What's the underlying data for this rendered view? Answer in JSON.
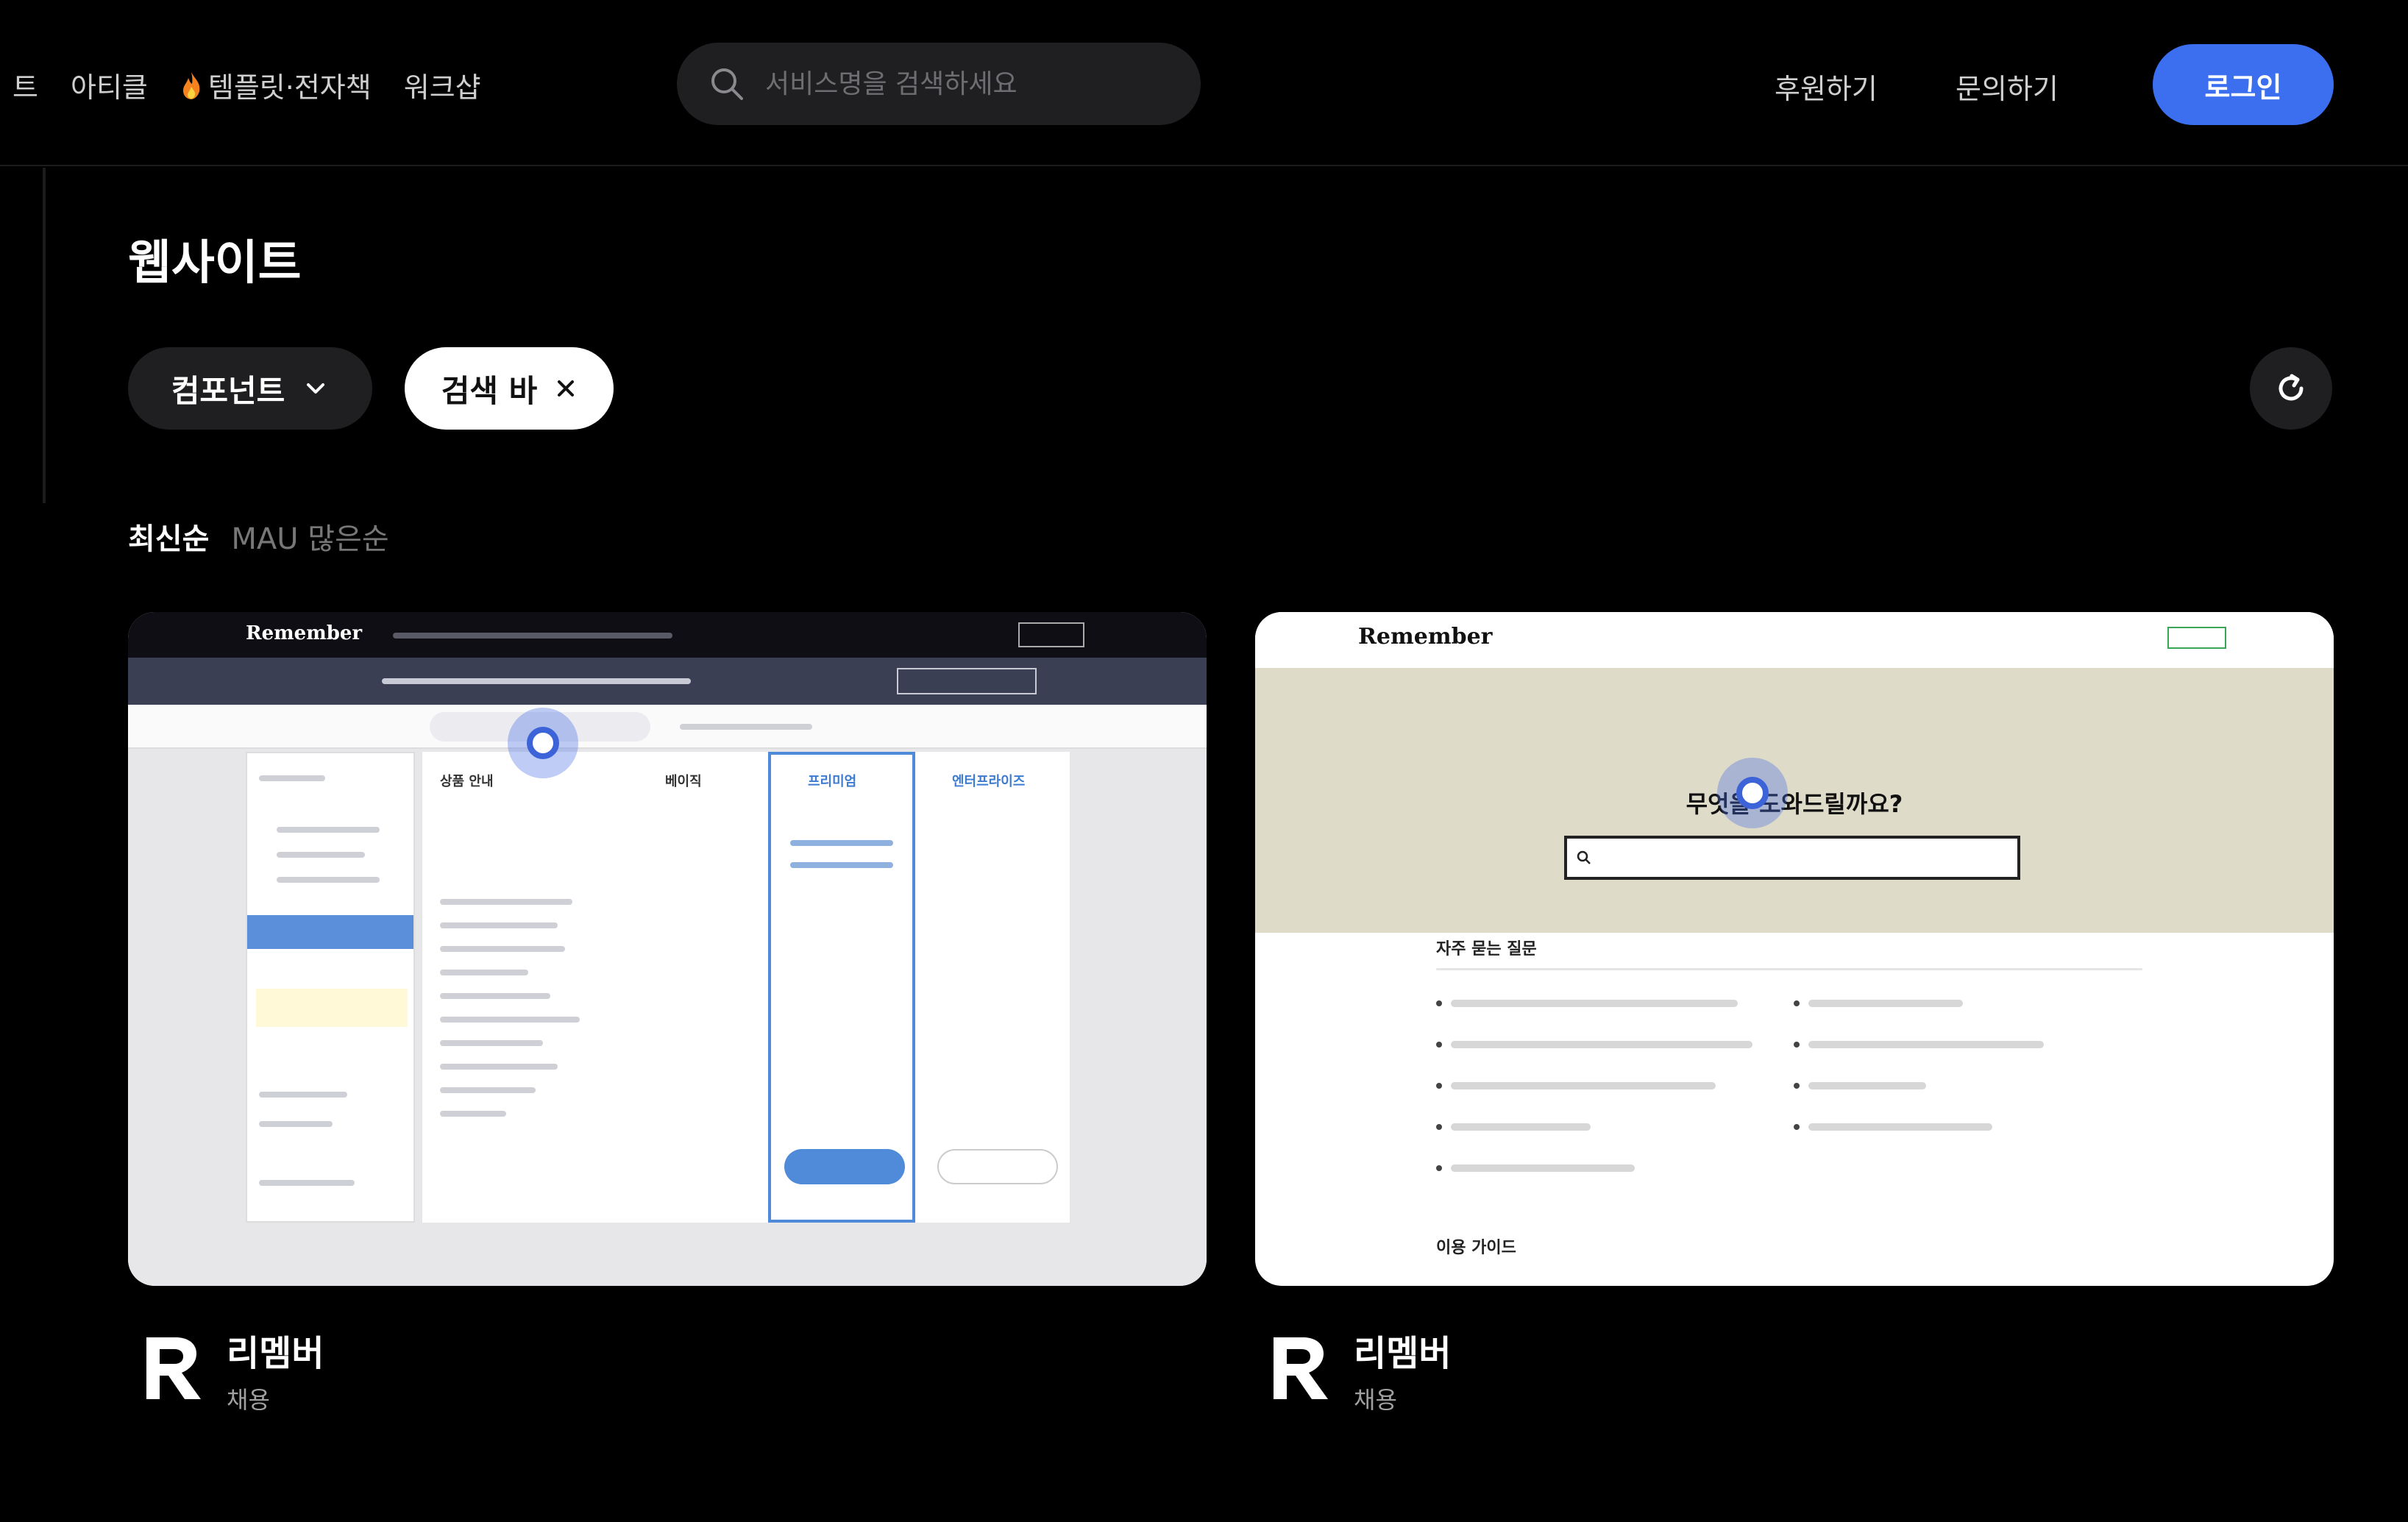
{
  "nav": {
    "cut_item": "트",
    "items": [
      "아티클",
      "템플릿·전자책",
      "워크샵"
    ]
  },
  "search": {
    "placeholder": "서비스명을 검색하세요"
  },
  "header_links": {
    "sponsor": "후원하기",
    "contact": "문의하기",
    "login": "로그인"
  },
  "page_title": "웹사이트",
  "filters": {
    "category": "컴포넌트",
    "active_tag": "검색 바"
  },
  "sort": {
    "latest": "최신순",
    "mau": "MAU 많은순"
  },
  "cards": [
    {
      "name": "리멤버",
      "category": "채용",
      "thumbnail": {
        "brand": "Remember",
        "labels": [
          "상품 안내",
          "베이직",
          "프리미엄",
          "엔터프라이즈"
        ]
      }
    },
    {
      "name": "리멤버",
      "category": "채용",
      "thumbnail": {
        "brand": "Remember",
        "question": "무엇을 도와드릴까요?",
        "faq_heading": "자주 묻는 질문",
        "guide_heading": "이용 가이드"
      }
    }
  ],
  "colors": {
    "accent": "#3b6ff0",
    "background": "#000000",
    "surface": "#1f1f21"
  }
}
